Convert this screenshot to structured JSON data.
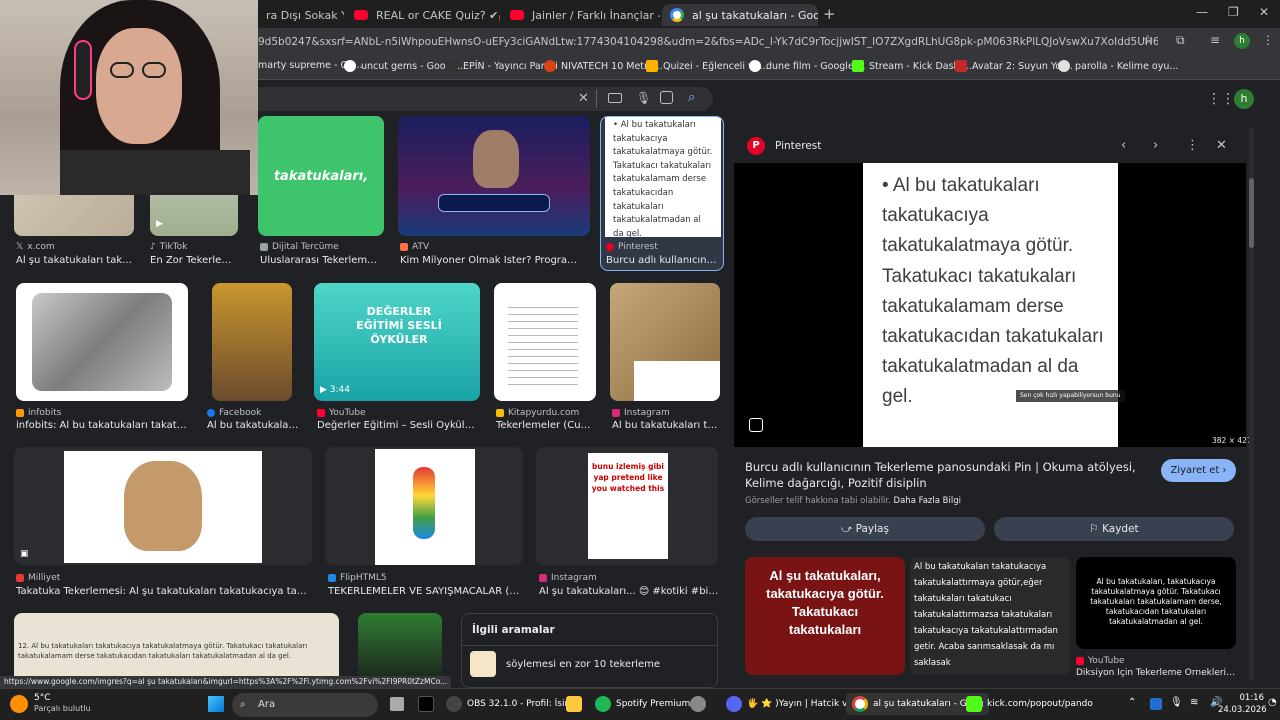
{
  "tabs": [
    {
      "label": "ra Dışı Sokak Ye",
      "icon": "youtube-icon"
    },
    {
      "label": "REAL or CAKE Quiz? ✔🍰❌",
      "icon": "youtube-icon"
    },
    {
      "label": "Jainler / Farklı İnançlar - YouTub",
      "icon": "youtube-icon"
    },
    {
      "label": "al şu takatukaları - Google'da A",
      "icon": "google-icon"
    }
  ],
  "address": {
    "url": "9d5b0247&sxsrf=ANbL-n5iWhpouEHwnsO-uEFy3ciGANdLtw:1774304104298&udm=2&fbs=ADc_l-Yk7dC9rTocjjwIST_IO7ZXgdRLhUG8pk-pM063RkPlLQJoVswXu7XoIdd5UH6fMlpVmXy93SCOvvhdXj3lBBc6ULDr0...",
    "profile": "h"
  },
  "bookmarks": [
    "marty supreme - Go...",
    "uncut gems - Googl...",
    "EPİN - Yayıncı Paneli",
    "NIVATECH 10 Metre...",
    "Quizei - Eğlenceli ve...",
    "dune film - Google'...",
    "Stream - Kick Dashb...",
    "Avatar 2: Suyun Yol...",
    "parolla - Kelime oyu..."
  ],
  "row1": [
    {
      "source": "x.com",
      "caption": "Al şu takatukaları takatu..."
    },
    {
      "source": "TikTok",
      "caption": "En Zor Tekerlemel..."
    },
    {
      "source": "Dijital Tercüme",
      "caption": "Uluslararası Tekerleme G...",
      "thumb_text": "takatukaları,"
    },
    {
      "source": "ATV",
      "caption": "Kim Milyoner Olmak İster? Programı Al b..."
    },
    {
      "source": "Pinterest",
      "caption": "Burcu adlı kullanıcının ..."
    }
  ],
  "row2": [
    {
      "source": "infobits",
      "caption": "infobits: Al bu takatukaları takatukacıy..."
    },
    {
      "source": "Facebook",
      "caption": "Al bu takatukaları t..."
    },
    {
      "source": "YouTube",
      "caption": "Değerler Eğitimi – Sesli Öyküler \"Al...",
      "thumb_text": "DEĞERLER EĞİTİMİ SESLİ ÖYKÜLER",
      "duration": "3:44"
    },
    {
      "source": "Kitapyurdu.com",
      "caption": "Tekerlemeler (Cuma..."
    },
    {
      "source": "Instagram",
      "caption": "Al bu takatukaları tak..."
    }
  ],
  "row3": [
    {
      "source": "Milliyet",
      "caption": "Takatuka Tekerlemesi: Al şu takatukaları takatukacıya takatukalat..."
    },
    {
      "source": "FlipHTML5",
      "caption": "TEKERLEMELER VE SAYIŞMACALAR (P..."
    },
    {
      "source": "Instagram",
      "caption": "Al şu takatukaları... 😊 #kotiki #bizleş...",
      "thumb_text": "bunu izlemiş gibi yap pretend like you watched this"
    }
  ],
  "row4": {
    "text": "12. Al bu takatukaları takatukacıya takatukalatmaya götür. Takatukacı takatukaları takatukalamam derse takatukacıdan takatukaları takatukalatmadan al da gel.",
    "related_title": "İlgili aramalar",
    "related_item": "söylemesi en zor 10 tekerleme"
  },
  "panel": {
    "source": "Pinterest",
    "card_text": "• Al bu takatukaları takatukacıya takatukalatmaya götür. Takatukacı takatukaları takatukalamam derse takatukacıdan takatukaları takatukalatmadan al da gel.",
    "overlay_text": "Sen çok hızlı yapabiliyorsun bunu",
    "dims": "382 × 427",
    "title": "Burcu adlı kullanıcının Tekerleme panosundaki Pin | Okuma atölyesi, Kelime dağarcığı, Pozitif disiplin",
    "visit": "Ziyaret et",
    "rights": "Görseller telif hakkına tabi olabilir.",
    "more_info": "Daha Fazla Bilgi",
    "share": "Paylaş",
    "save": "Kaydet",
    "related": [
      {
        "text": "Al şu takatukaları, takatukacıya götür. Takatukacı takatukaları"
      },
      {
        "text": "Al bu takatukaları takatukacıya takatukalattırmaya götür,eğer takatukaları takatukacı takatukalattırmazsa takatukaları takatukacıya takatukalattırmadan getir. Acaba sarımsaklasak da mı saklasak"
      },
      {
        "text": "Al bu takatukaları, takatukacıya takatukalatmaya götür. Takatukacı takatukaları takatukalamam derse, takatukacıdan takatukaları takatukalatmadan al gel.",
        "source": "YouTube",
        "caption": "Diksiyon İçin Tekerleme Örnekleri - 14"
      }
    ]
  },
  "status_url": "https://www.google.com/imgres?q=al şu takatukaları&imgurl=https%3A%2F%2Fi.ytimg.com%2Fvi%2FI9PR0tZzMCo...",
  "taskbar": {
    "weather_temp": "5°C",
    "weather_desc": "Parçalı bulutlu",
    "search": "Ara",
    "apps": [
      "OBS 32.1.0 - Profil: İsims",
      "Spotify Premium",
      "🖐 ⭐ )Yayın | Hatcik ve Ye",
      "al şu takatukaları - Goog",
      "kick.com/popout/pando"
    ],
    "time": "01:16",
    "date": "24.03.2026"
  }
}
